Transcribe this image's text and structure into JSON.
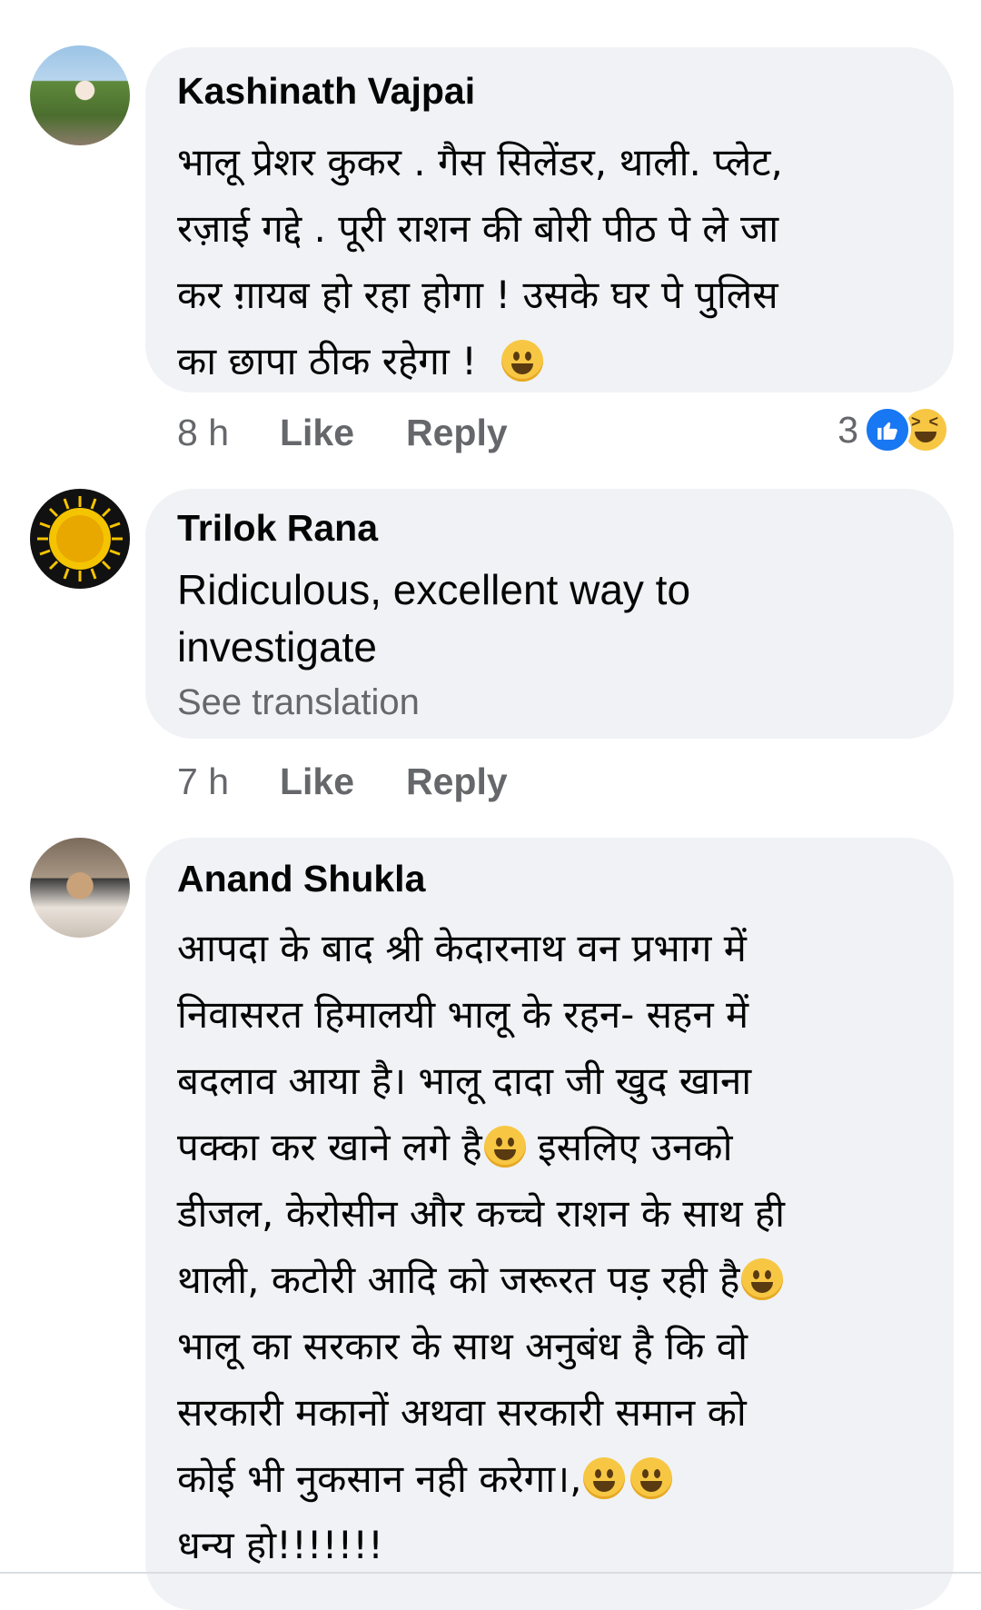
{
  "comments": [
    {
      "author": "Kashinath Vajpai",
      "text_lines": [
        "भालू प्रेशर कुकर . गैस सिलेंडर, थाली. प्लेट,",
        "रज़ाई गद्दे . पूरी राशन की बोरी पीठ पे ले जा",
        "कर ग़ायब हो रहा होगा ! उसके घर पे पुलिस",
        "का छापा ठीक रहेगा !"
      ],
      "emoji": "grinning-face",
      "time": "8 h",
      "like": "Like",
      "reply": "Reply",
      "reaction_count": "3",
      "reactions": [
        "like",
        "haha"
      ]
    },
    {
      "author": "Trilok Rana",
      "text_lines": [
        "Ridiculous, excellent way to",
        "investigate"
      ],
      "see_translation": "See translation",
      "time": "7 h",
      "like": "Like",
      "reply": "Reply"
    },
    {
      "author": "Anand Shukla",
      "text_lines": [
        "आपदा के बाद श्री केदारनाथ वन प्रभाग में",
        "निवासरत हिमालयी भालू के रहन- सहन में",
        "बदलाव आया है। भालू दादा जी खुद खाना",
        "पक्का कर खाने लगे है",
        " इसलिए उनको",
        "डीजल, केरोसीन और कच्चे राशन के साथ ही",
        "थाली, कटोरी आदि को जरूरत पड़ रही है",
        "भालू का सरकार के साथ अनुबंध है कि वो",
        "सरकारी मकानों अथवा सरकारी समान को",
        "कोई भी नुकसान नही करेगा।,",
        "धन्य हो!!!!!!!"
      ]
    }
  ]
}
